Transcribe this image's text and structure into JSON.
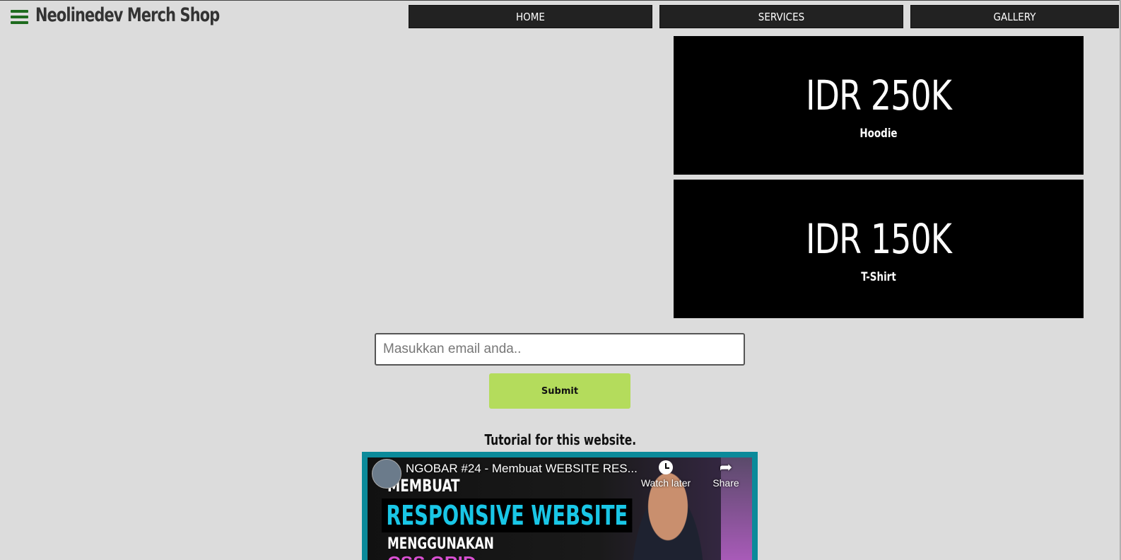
{
  "header": {
    "title": "Neolinedev Merch Shop",
    "menu_icon": "hamburger-menu-icon",
    "accent_color": "#1e6b1e"
  },
  "nav": {
    "items": [
      {
        "label": "HOME"
      },
      {
        "label": "SERVICES"
      },
      {
        "label": "GALLERY"
      }
    ]
  },
  "products": [
    {
      "price": "IDR 250K",
      "name": "Hoodie"
    },
    {
      "price": "IDR 150K",
      "name": "T-Shirt"
    }
  ],
  "subscribe": {
    "email_placeholder": "Masukkan email anda..",
    "submit_label": "Submit",
    "submit_color": "#b4dc5c"
  },
  "tutorial": {
    "label": "Tutorial for this website.",
    "video": {
      "title": "NGOBAR #24 - Membuat WEBSITE RES...",
      "watch_later_label": "Watch later",
      "share_label": "Share",
      "thumbnail_text_1": "MEMBUAT",
      "thumbnail_text_2": "RESPONSIVE WEBSITE",
      "thumbnail_text_3": "MENGGUNAKAN",
      "thumbnail_text_4": "CSS GRID"
    }
  }
}
